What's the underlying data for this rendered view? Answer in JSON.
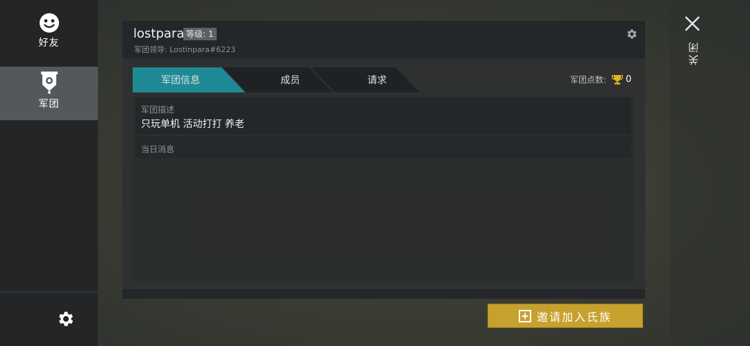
{
  "sidebar": {
    "items": [
      {
        "label": "好友",
        "icon": "smiley-face-icon"
      },
      {
        "label": "军团",
        "icon": "legion-banner-icon"
      }
    ],
    "settings_icon": "gear-icon"
  },
  "header": {
    "clan_name": "lostpara",
    "level": "等级: 1",
    "leader": "军团领导: Lostinpara#6223"
  },
  "tabs": [
    {
      "label": "军团信息",
      "active": true
    },
    {
      "label": "成员",
      "active": false
    },
    {
      "label": "请求",
      "active": false
    }
  ],
  "points": {
    "label": "军团点数:",
    "value": "0",
    "icon": "trophy-icon"
  },
  "description": {
    "title": "军团描述",
    "text": "只玩单机 活动打打 养老"
  },
  "daily_message": {
    "title": "当日消息"
  },
  "invite_button": {
    "label": "邀请加入氏族",
    "icon": "plus-box-icon"
  },
  "close": {
    "label": "关闭",
    "icon": "close-icon"
  },
  "colors": {
    "active_tab": "#1f8a96",
    "inactive_tab": "#1f2224",
    "invite_button": "#c7a12e",
    "trophy": "#e3b322"
  }
}
